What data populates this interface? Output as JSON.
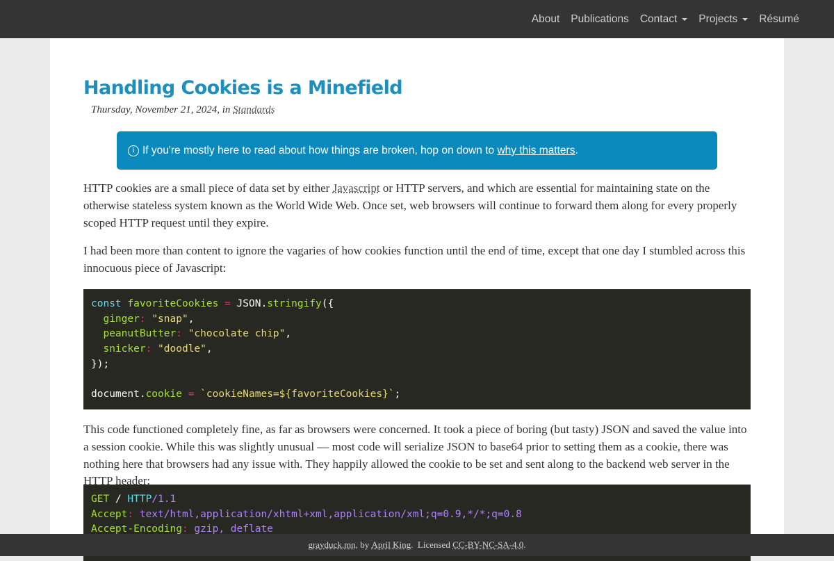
{
  "nav": {
    "about": "About",
    "publications": "Publications",
    "contact": "Contact",
    "projects": "Projects",
    "resume": "Résumé"
  },
  "article": {
    "title": "Handling Cookies is a Minefield",
    "date": "Thursday, November 21, 2024, in",
    "category": "Standards",
    "alert_text": "If you're mostly here to read about how things are broken, hop on down to",
    "alert_link": "why this matters",
    "alert_end": ".",
    "p1_before": "HTTP cookies are a small piece of data set by either",
    "p1_link": "Javascript",
    "p1_after": "or HTTP servers, and which are essential for maintaining state on the otherwise stateless system known as the World Wide Web. Once set, web browsers will continue to forward them along for every properly scoped HTTP request until they expire.",
    "p2": "I had been more than content to ignore the vagaries of how cookies function until the end of time, except that one day I stumbled across this innocuous piece of Javascript:",
    "p3": "This code functioned completely fine, as far as browsers were concerned. It took a piece of boring (but tasty) JSON and saved the value into a session cookie. While this was slightly unusual — most code will serialize JSON to base64 prior to setting them as a cookie, there was nothing here that browsers had any issue with. They happily allowed the cookie to be set and sent along to the backend web server in the HTTP header:"
  },
  "code1": {
    "l1_kw": "const",
    "l1_var": "favoriteCookies",
    "l1_eq": "=",
    "l1_obj": "JSON.",
    "l1_fn": "stringify",
    "l1_open": "({",
    "l2_key": "ginger",
    "l2_val": "\"snap\"",
    "l3_key": "peanutButter",
    "l3_val": "\"chocolate chip\"",
    "l4_key": "snicker",
    "l4_val": "\"doodle\"",
    "l5": "});",
    "l7_obj": "document.",
    "l7_prop": "cookie",
    "l7_eq": "=",
    "l7_tpl": "`cookieNames=${favoriteCookies}`",
    "l7_end": ";"
  },
  "code2": {
    "l1_method": "GET",
    "l1_path": "/",
    "l1_proto": "HTTP",
    "l1_ver": "/1.1",
    "l2_key": "Accept",
    "l2_val": "text/html,application/xhtml+xml,application/xml;q=0.9,*/*;q=0.8",
    "l3_key": "Accept-Encoding",
    "l3_val": "gzip, deflate"
  },
  "footer": {
    "site": "grayduck.mn",
    "by": ", by",
    "author": "April King",
    "licensed": ".  Licensed",
    "license": "CC-BY-NC-SA-4.0",
    "end": "."
  }
}
